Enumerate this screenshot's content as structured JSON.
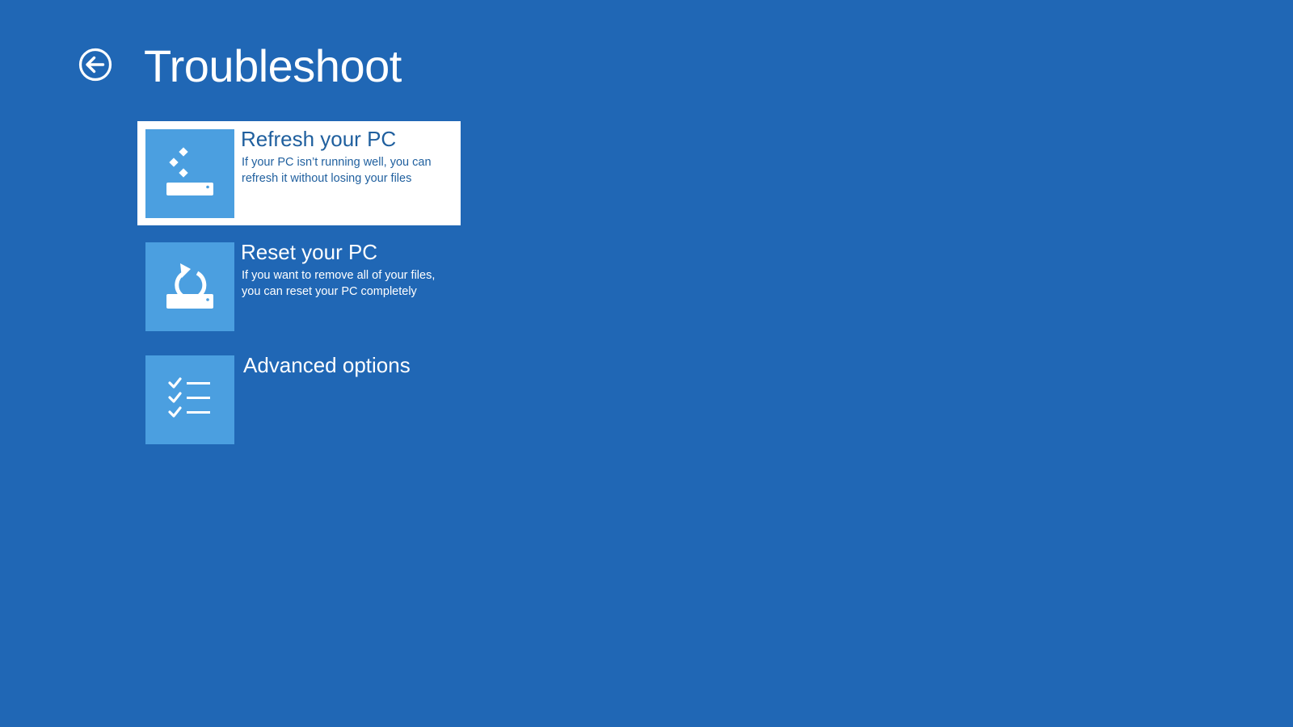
{
  "page": {
    "title": "Troubleshoot",
    "back_icon": "back-arrow-circle-icon"
  },
  "colors": {
    "background": "#2067b5",
    "tile": "#4b9fe0",
    "selected_background": "#ffffff",
    "selected_text": "#1f5f9e",
    "text": "#ffffff"
  },
  "options": [
    {
      "title": "Refresh your PC",
      "description": "If your PC isn’t running well, you can refresh it without losing your files",
      "icon": "refresh-pc-icon",
      "selected": true
    },
    {
      "title": "Reset your PC",
      "description": "If you want to remove all of your files, you can reset your PC completely",
      "icon": "reset-pc-icon",
      "selected": false
    },
    {
      "title": "Advanced options",
      "description": "",
      "icon": "checklist-icon",
      "selected": false
    }
  ]
}
